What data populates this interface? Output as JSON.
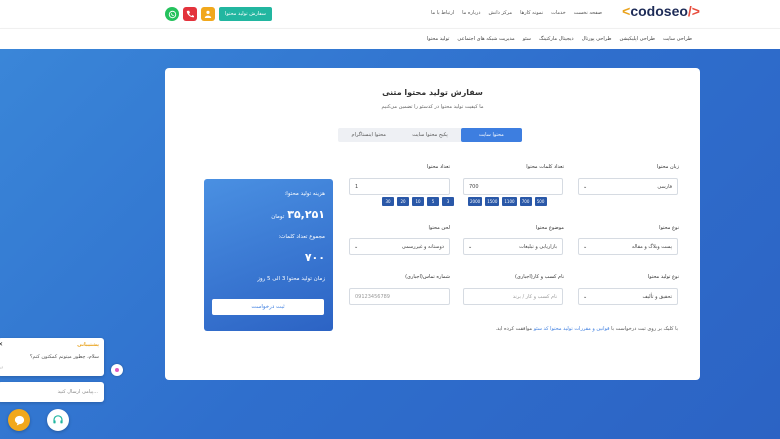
{
  "header": {
    "logo_prefix": "<",
    "logo_text": "codoseo",
    "logo_suffix": "/>",
    "nav": [
      "صفحه نخست",
      "خدمات",
      "نمونه کارها",
      "مرکز دانش",
      "درباره ما",
      "ارتباط با ما"
    ],
    "cta_label": "سفارش تولید محتوا",
    "icons": [
      "user-icon",
      "phone-icon",
      "whatsapp-icon"
    ]
  },
  "subnav": [
    "طراحی سایت",
    "طراحی اپلیکیشن",
    "طراحی پورتال",
    "دیجیتال مارکتینگ",
    "سئو",
    "مدیریت شبکه های اجتماعی",
    "تولید محتوا"
  ],
  "card": {
    "title": "سفارش تولید محتوا متنی",
    "subtitle": "ما کیفیت تولید محتوا در کدسئو را تضمین می‌کنیم",
    "tabs": [
      {
        "label": "محتوا سایت",
        "active": true
      },
      {
        "label": "پکیج محتوا سایت",
        "active": false
      },
      {
        "label": "محتوا اینستاگرام",
        "active": false
      }
    ]
  },
  "form": {
    "language": {
      "label": "زبان محتوا",
      "value": "فارسی"
    },
    "word_count": {
      "label": "تعداد کلمات محتوا",
      "value": "700",
      "chips": [
        "500",
        "700",
        "1100",
        "1500",
        "2000"
      ]
    },
    "quantity": {
      "label": "تعداد محتوا",
      "value": "1",
      "chips": [
        "3",
        "5",
        "10",
        "20",
        "30"
      ]
    },
    "content_type": {
      "label": "نوع محتوا",
      "value": "پست وبلاگ و مقاله"
    },
    "topic": {
      "label": "موضوع محتوا",
      "value": "بازاریابی و تبلیغات"
    },
    "tone": {
      "label": "لحن محتوا",
      "value": "دوستانه و غیررسمی"
    },
    "production_type": {
      "label": "نوع تولید محتوا",
      "value": "تحقیق و تألیف"
    },
    "name": {
      "label": "نام کسب و کار(اجباری)",
      "placeholder": "نام کسب و کار / برند"
    },
    "phone": {
      "label": "شماره تماس(اجباری)",
      "placeholder": "09123456789"
    }
  },
  "summary": {
    "cost_label": "هزینه تولید محتوا:",
    "cost_value": "۳۵,۲۵۱",
    "cost_unit": "تومان",
    "words_label": "مجموع تعداد کلمات:",
    "words_value": "۷۰۰",
    "time_text": "زمان تولید محتوا 3 الی 5 روز",
    "submit_label": "ثبت درخواست"
  },
  "terms": {
    "prefix": "با کلیک بر روی ثبت درخواست با",
    "link": "قوانین و مقررات تولید محتوا کد سئو",
    "suffix": "موافقت کرده اید."
  },
  "chat": {
    "title": "پشتیبانی",
    "message": "سلام، چطور میتونم کمکتون کنم؟",
    "time": "۱۶",
    "input_placeholder": "پیامی ارسال کنید..."
  }
}
